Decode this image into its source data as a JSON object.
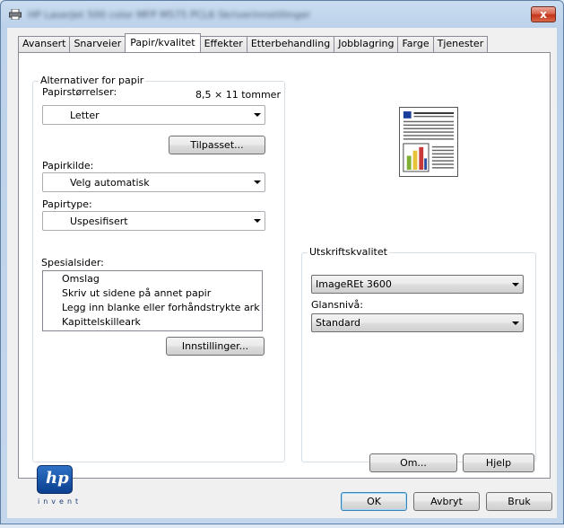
{
  "window": {
    "title": "HP LaserJet 500 color MFP M575 PCL6 Skriverinnstillinger",
    "close_label": "x"
  },
  "tabs": [
    {
      "label": "Avansert"
    },
    {
      "label": "Snarveier"
    },
    {
      "label": "Papir/kvalitet",
      "active": true
    },
    {
      "label": "Effekter"
    },
    {
      "label": "Etterbehandling"
    },
    {
      "label": "Jobblagring"
    },
    {
      "label": "Farge"
    },
    {
      "label": "Tjenester"
    }
  ],
  "paper_options": {
    "legend": "Alternativer for papir",
    "size_label": "Papirstørrelser:",
    "size_dimensions": "8,5 × 11 tommer",
    "size_value": "Letter",
    "custom_button": "Tilpasset...",
    "source_label": "Papirkilde:",
    "source_value": "Velg automatisk",
    "type_label": "Papirtype:",
    "type_value": "Uspesifisert"
  },
  "special_pages": {
    "label": "Spesialsider:",
    "items": [
      "Omslag",
      "Skriv ut sidene på annet papir",
      "Legg inn blanke eller forhåndstrykte ark",
      "Kapittelskilleark"
    ],
    "settings_button": "Innstillinger..."
  },
  "print_quality": {
    "legend": "Utskriftskvalitet",
    "quality_value": "ImageREt 3600",
    "gloss_label": "Glansnivå:",
    "gloss_value": "Standard"
  },
  "logo": {
    "mark": "hp",
    "tagline": "invent"
  },
  "panel_buttons": {
    "about": "Om...",
    "help": "Hjelp"
  },
  "dialog_buttons": {
    "ok": "OK",
    "cancel": "Avbryt",
    "apply": "Bruk"
  },
  "icons": {
    "title": "printer-icon",
    "preview": "document-preview-icon"
  }
}
